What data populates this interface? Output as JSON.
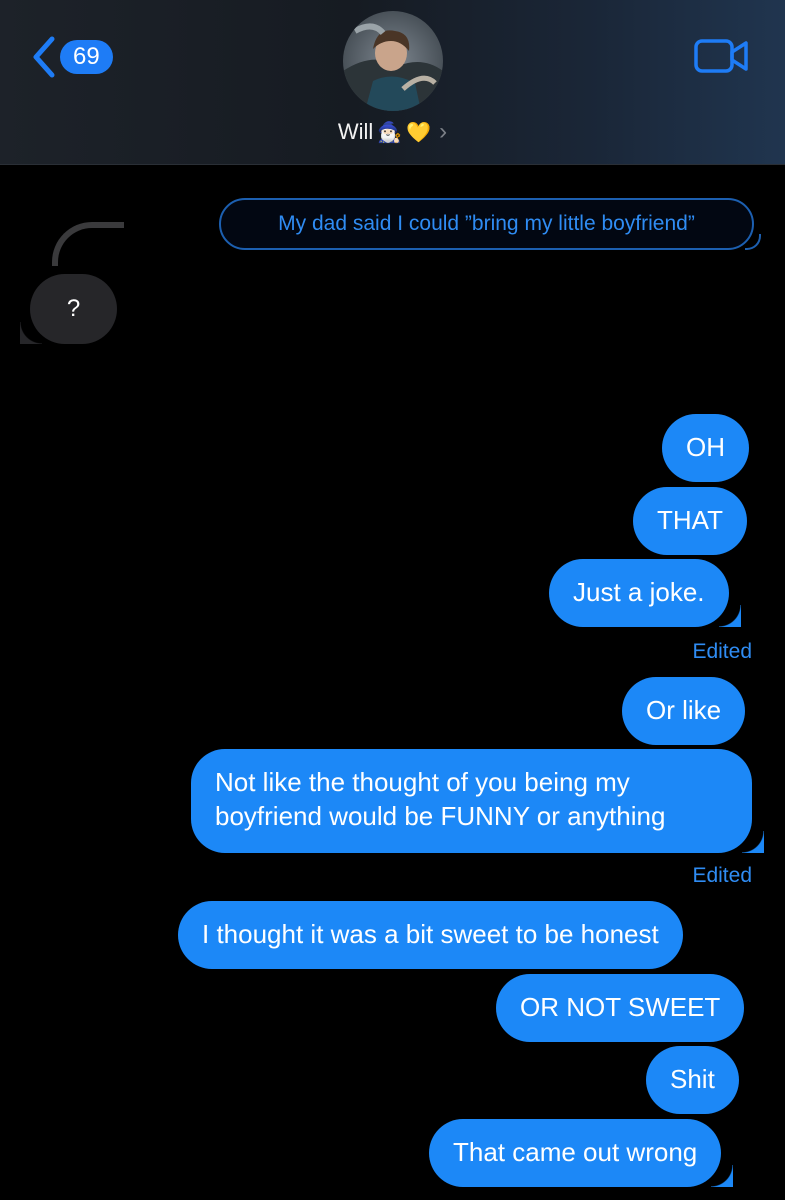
{
  "header": {
    "back_count": "69",
    "contact_name": "Will",
    "name_emoji_1": "🧙🏻‍♂️",
    "name_emoji_2": "💛",
    "chevron": "›",
    "icons": {
      "back": "chevron-left-icon",
      "video": "video-camera-icon"
    }
  },
  "thread": {
    "quoted_message": "My dad said I could ”bring my little boyfriend”",
    "received_reply": "?",
    "sent": [
      "OH",
      "THAT",
      "Just a joke.",
      "Or like",
      "Not like the thought of you being my boyfriend would be FUNNY or anything",
      "I thought it was a bit sweet to be honest",
      "OR NOT SWEET",
      "Shit",
      "That came out wrong"
    ],
    "edited_label_1": "Edited",
    "edited_label_2": "Edited"
  },
  "colors": {
    "accent": "#1c88f7",
    "received_bubble": "#262629",
    "background": "#000000"
  }
}
